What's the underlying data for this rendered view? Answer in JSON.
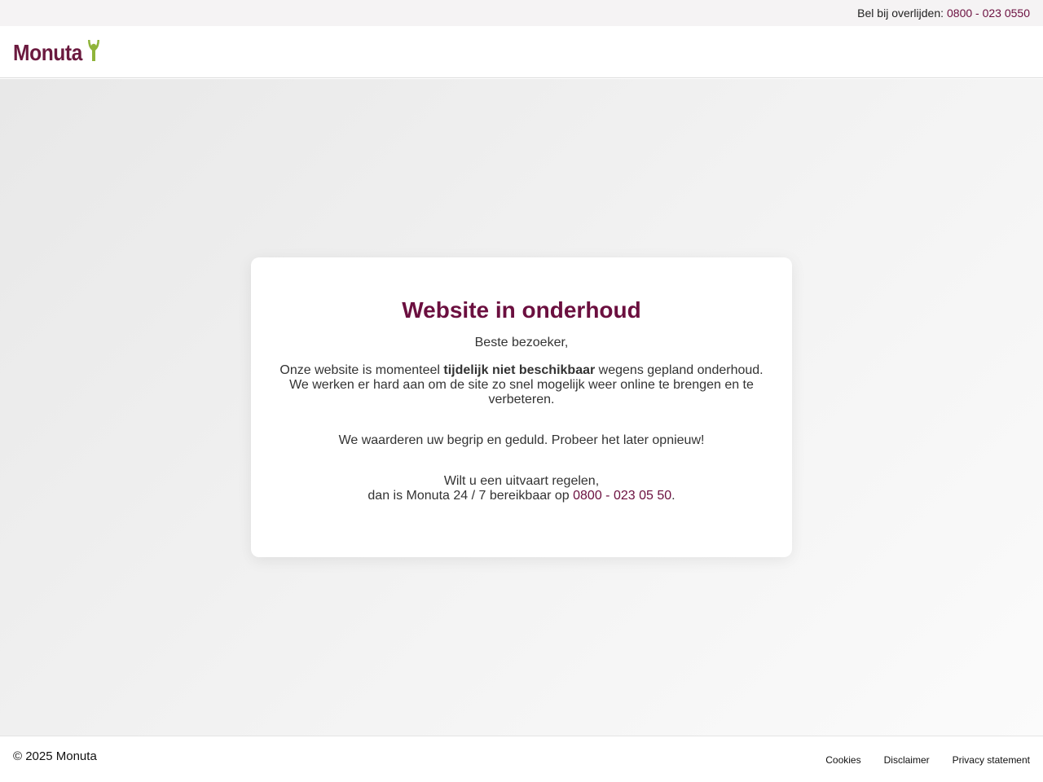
{
  "topbar": {
    "label": "Bel bij overlijden:",
    "phone": "0800 - 023 0550"
  },
  "header": {
    "logo_text": "Monuta"
  },
  "colors": {
    "brand": "#6b0f3f",
    "logo_green": "#8fb43a"
  },
  "card": {
    "title": "Website in onderhoud",
    "greeting": "Beste bezoeker,",
    "intro_before": "Onze website is momenteel ",
    "intro_bold": "tijdelijk niet beschikbaar",
    "intro_after": " wegens gepland onderhoud. We werken er hard aan om de site zo snel mogelijk weer online te brengen en te verbeteren.",
    "thanks": "We waarderen uw begrip en geduld. Probeer het later opnieuw!",
    "contact_line1": "Wilt u een uitvaart regelen,",
    "contact_line2_before": "dan is Monuta 24 / 7 bereikbaar op ",
    "contact_phone": "0800 - 023 05 50",
    "contact_line2_after": "."
  },
  "footer": {
    "copyright": "© 2025 Monuta",
    "links": [
      "Cookies",
      "Disclaimer",
      "Privacy statement"
    ]
  }
}
